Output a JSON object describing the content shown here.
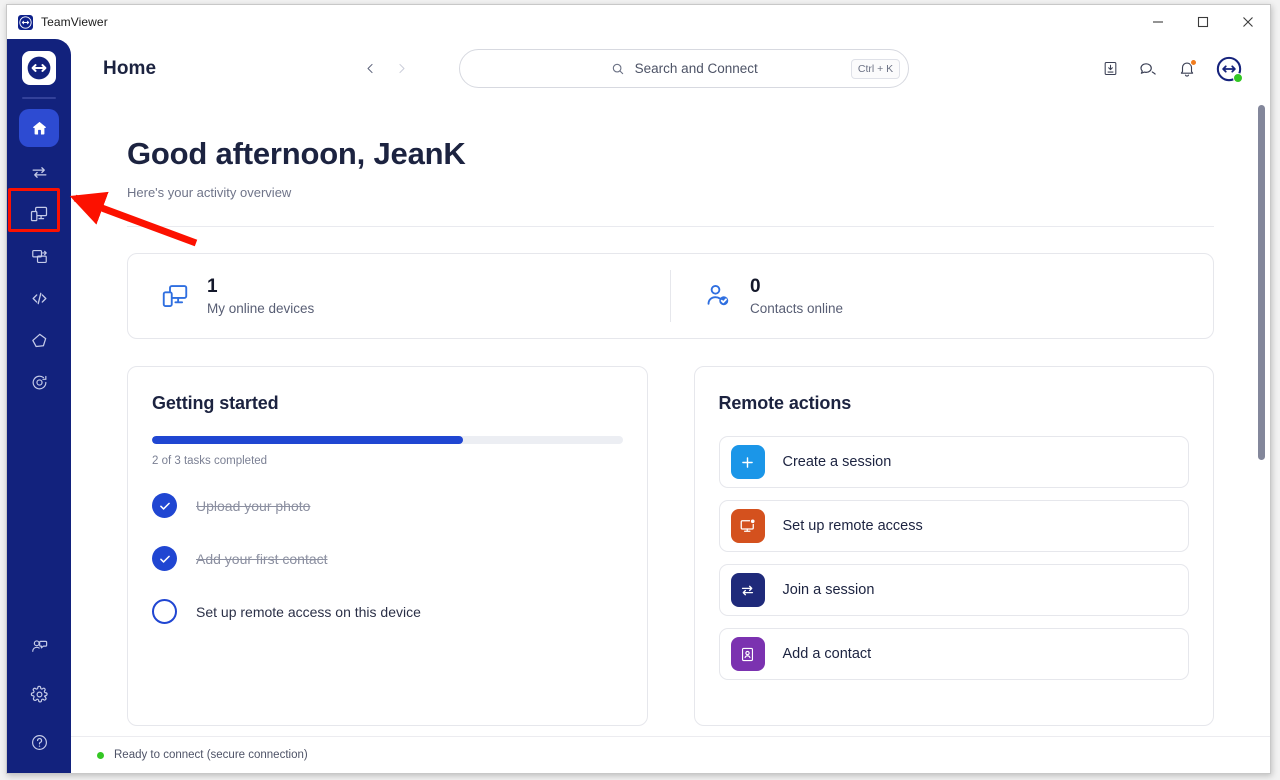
{
  "window": {
    "title": "TeamViewer",
    "controls": {
      "minimize": "minimize-button",
      "maximize": "maximize-button",
      "close": "close-button"
    }
  },
  "sidebar": {
    "logo": "teamviewer-logo",
    "items": [
      {
        "name": "home",
        "icon": "home-icon",
        "active": true
      },
      {
        "name": "remote-control",
        "icon": "transfer-arrows-icon",
        "active": false
      },
      {
        "name": "devices",
        "icon": "devices-icon",
        "active": false,
        "highlighted": true
      },
      {
        "name": "file-transfer",
        "icon": "file-transfer-icon",
        "active": false
      },
      {
        "name": "scripts",
        "icon": "code-brackets-icon",
        "active": false
      },
      {
        "name": "augmented-reality",
        "icon": "diamond-icon",
        "active": false
      },
      {
        "name": "monitoring",
        "icon": "target-icon",
        "active": false
      }
    ],
    "bottom_items": [
      {
        "name": "feedback",
        "icon": "person-chat-icon"
      },
      {
        "name": "settings",
        "icon": "gear-icon"
      },
      {
        "name": "help",
        "icon": "question-mark-icon"
      }
    ]
  },
  "header": {
    "title": "Home",
    "nav_back": "chevron-left-icon",
    "nav_forward": "chevron-right-icon",
    "search": {
      "placeholder": "Search and Connect",
      "shortcut": "Ctrl + K",
      "icon": "search-icon"
    },
    "right_icons": [
      {
        "name": "downloads",
        "icon": "download-box-icon"
      },
      {
        "name": "chat",
        "icon": "chat-bubbles-icon"
      },
      {
        "name": "notifications",
        "icon": "bell-icon",
        "badge": true
      },
      {
        "name": "account-avatar",
        "icon": "teamviewer-avatar-icon",
        "status": "online"
      }
    ]
  },
  "main": {
    "greeting": "Good afternoon, JeanK",
    "subtitle": "Here's your activity overview",
    "stats": [
      {
        "icon": "devices-icon",
        "value": "1",
        "label": "My online devices"
      },
      {
        "icon": "contact-check-icon",
        "value": "0",
        "label": "Contacts online"
      }
    ],
    "getting_started": {
      "title": "Getting started",
      "progress_percent": 66,
      "progress_label": "2 of 3 tasks completed",
      "tasks": [
        {
          "label": "Upload your photo",
          "completed": true
        },
        {
          "label": "Add your first contact",
          "completed": true
        },
        {
          "label": "Set up remote access on this device",
          "completed": false
        }
      ]
    },
    "remote_actions": {
      "title": "Remote actions",
      "items": [
        {
          "label": "Create a session",
          "icon": "plus-icon",
          "color": "#1b96e8"
        },
        {
          "label": "Set up remote access",
          "icon": "monitor-gear-icon",
          "color": "#d4511e"
        },
        {
          "label": "Join a session",
          "icon": "transfer-arrows-icon",
          "color": "#1f2a7a"
        },
        {
          "label": "Add a contact",
          "icon": "contact-book-icon",
          "color": "#7b32b0"
        }
      ]
    }
  },
  "statusbar": {
    "text": "Ready to connect (secure connection)",
    "indicator_color": "#34c724"
  },
  "colors": {
    "sidebar_bg": "#12227d",
    "accent_blue": "#2046d2",
    "active_item": "#2d4bd2",
    "annotation_red": "#fc1100"
  }
}
